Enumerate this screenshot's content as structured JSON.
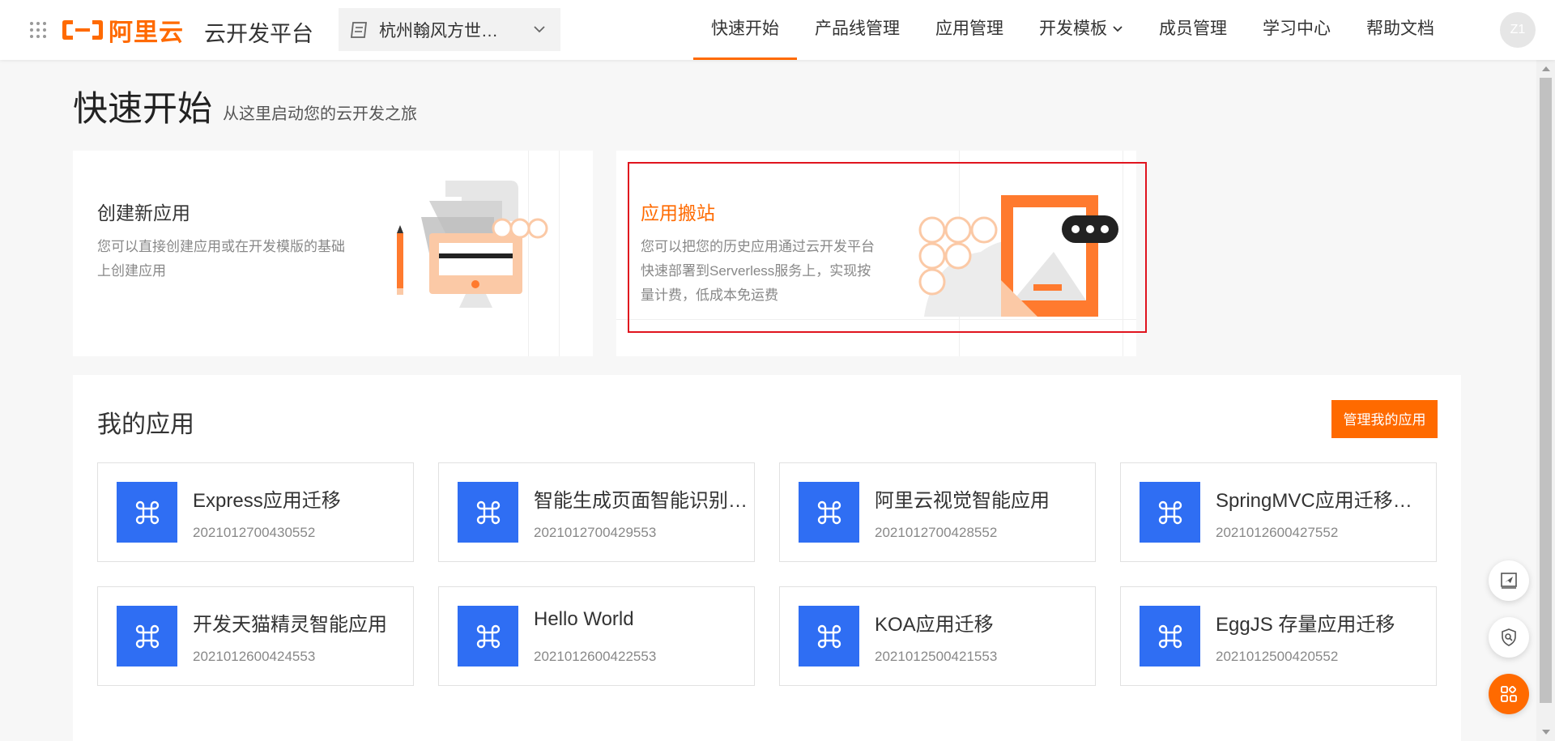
{
  "header": {
    "logo_text": "阿里云",
    "platform_name": "云开发平台",
    "org_select_value": "杭州翰风方世…",
    "nav": [
      {
        "label": "快速开始",
        "active": true
      },
      {
        "label": "产品线管理"
      },
      {
        "label": "应用管理"
      },
      {
        "label": "开发模板",
        "dropdown": true
      },
      {
        "label": "成员管理"
      },
      {
        "label": "学习中心"
      },
      {
        "label": "帮助文档"
      }
    ],
    "avatar_text": "Z1"
  },
  "page": {
    "title": "快速开始",
    "subtitle": "从这里启动您的云开发之旅"
  },
  "quick_cards": [
    {
      "title": "创建新应用",
      "desc": "您可以直接创建应用或在开发模版的基础上创建应用"
    },
    {
      "title": "应用搬站",
      "desc": "您可以把您的历史应用通过云开发平台快速部署到Serverless服务上，实现按量计费，低成本免运费"
    }
  ],
  "apps": {
    "title": "我的应用",
    "manage_label": "管理我的应用",
    "items": [
      {
        "name": "Express应用迁移",
        "id": "2021012700430552"
      },
      {
        "name": "智能生成页面智能识别…",
        "id": "2021012700429553"
      },
      {
        "name": "阿里云视觉智能应用",
        "id": "2021012700428552"
      },
      {
        "name": "SpringMVC应用迁移方…",
        "id": "2021012600427552"
      },
      {
        "name": "开发天猫精灵智能应用",
        "id": "2021012600424553"
      },
      {
        "name": "Hello World",
        "id": "2021012600422553"
      },
      {
        "name": "KOA应用迁移",
        "id": "2021012500421553"
      },
      {
        "name": "EggJS 存量应用迁移",
        "id": "2021012500420552"
      }
    ]
  },
  "colors": {
    "brand": "#ff6a00",
    "app_icon": "#2f6ef3",
    "highlight": "#e0141e"
  },
  "icons": [
    "grid-icon",
    "aliyun-logo-icon",
    "org-icon",
    "chevron-down-icon",
    "app-command-icon",
    "send-icon",
    "shield-key-icon",
    "apps-icon"
  ]
}
